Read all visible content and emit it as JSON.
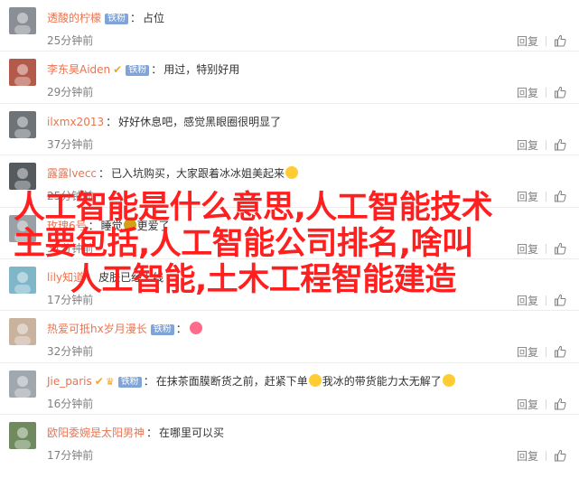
{
  "comments": [
    {
      "user": "透酸的柠檬",
      "badge": "铁粉",
      "v": false,
      "crown": false,
      "text": "占位",
      "time": "25分钟前",
      "reply": "回复",
      "avatar_color": "#8a8f96"
    },
    {
      "user": "李东昊Aiden",
      "badge": "铁粉",
      "v": true,
      "crown": false,
      "text": "用过，特别好用",
      "time": "29分钟前",
      "reply": "回复",
      "avatar_color": "#b45a4a"
    },
    {
      "user": "ilxmx2013",
      "badge": "",
      "v": false,
      "crown": false,
      "text": "好好休息吧，感觉黑眼圈很明显了",
      "time": "37分钟前",
      "reply": "回复",
      "avatar_color": "#6e7378"
    },
    {
      "user": "露露lvecc",
      "badge": "",
      "v": false,
      "crown": false,
      "text": "已入坑购买，大家跟着冰冰姐美起来",
      "time": "25分钟前",
      "reply": "回复",
      "avatar_color": "#555a5e"
    },
    {
      "user": "玫瑰6号",
      "badge": "",
      "v": false,
      "crown": false,
      "text": "睡觉",
      "text2": "更爱了",
      "time": "31分钟前",
      "reply": "回复",
      "avatar_color": "#9aa1a6"
    },
    {
      "user": "lily知道",
      "badge": "",
      "v": false,
      "crown": false,
      "text": "皮肤已经上线",
      "time": "17分钟前",
      "reply": "回复",
      "avatar_color": "#7fb6c8"
    },
    {
      "user": "热爱可抵hx岁月漫长",
      "badge": "铁粉",
      "v": false,
      "crown": false,
      "text": "",
      "time": "32分钟前",
      "reply": "回复",
      "avatar_color": "#c9b39e"
    },
    {
      "user": "Jie_paris",
      "badge": "铁粉",
      "v": true,
      "crown": true,
      "text": "在抹茶面膜断货之前，赶紧下单",
      "text2": "我冰的带货能力太无解了",
      "time": "16分钟前",
      "reply": "回复",
      "avatar_color": "#a0a7ad"
    },
    {
      "user": "欧阳委婉是太阳男神",
      "badge": "",
      "v": false,
      "crown": false,
      "text": "在哪里可以买",
      "time": "17分钟前",
      "reply": "回复",
      "avatar_color": "#6f8a5e"
    }
  ],
  "overlay": {
    "line1": "人工智能是什么意思,人工智能技术",
    "line2": "主要包括,人工智能公司排名,啥叫",
    "line3": "人工智能,土木工程智能建造"
  },
  "colors": {
    "username": "#eb7350",
    "overlay": "#ff1f1f",
    "badge": "#7fa4d8",
    "meta": "#808080"
  }
}
